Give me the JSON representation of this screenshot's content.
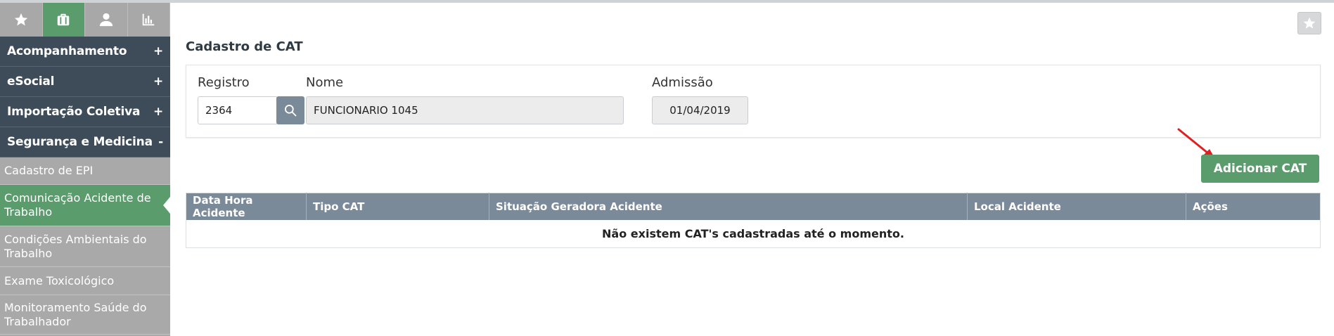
{
  "sidebar": {
    "top_tabs": [
      {
        "icon": "star-icon",
        "active": false
      },
      {
        "icon": "briefcase-icon",
        "active": true
      },
      {
        "icon": "user-icon",
        "active": false
      },
      {
        "icon": "bar-chart-icon",
        "active": false
      }
    ],
    "groups": [
      {
        "label": "Acompanhamento",
        "toggle": "+"
      },
      {
        "label": "eSocial",
        "toggle": "+"
      },
      {
        "label": "Importação Coletiva",
        "toggle": "+"
      },
      {
        "label": "Segurança e Medicina",
        "toggle": "-"
      }
    ],
    "subitems": [
      {
        "label": "Cadastro de EPI"
      },
      {
        "label": "Comunicação Acidente de Trabalho"
      },
      {
        "label": "Condições Ambientais do Trabalho"
      },
      {
        "label": "Exame Toxicológico"
      },
      {
        "label": "Monitoramento Saúde do Trabalhador"
      }
    ]
  },
  "main": {
    "title": "Cadastro de CAT",
    "registro_label": "Registro",
    "registro_value": "2364",
    "nome_label": "Nome",
    "nome_value": "FUNCIONARIO 1045",
    "admissao_label": "Admissão",
    "admissao_value": "01/04/2019",
    "add_button": "Adicionar CAT",
    "table": {
      "headers": [
        "Data Hora Acidente",
        "Tipo CAT",
        "Situação Geradora Acidente",
        "Local Acidente",
        "Ações"
      ],
      "empty_message": "Não existem CAT's cadastradas até o momento."
    }
  },
  "colors": {
    "accent_green": "#5a9c6c",
    "sidebar_dark": "#3e4c5a",
    "header_gray": "#7b8a99",
    "arrow_red": "#e02020"
  }
}
